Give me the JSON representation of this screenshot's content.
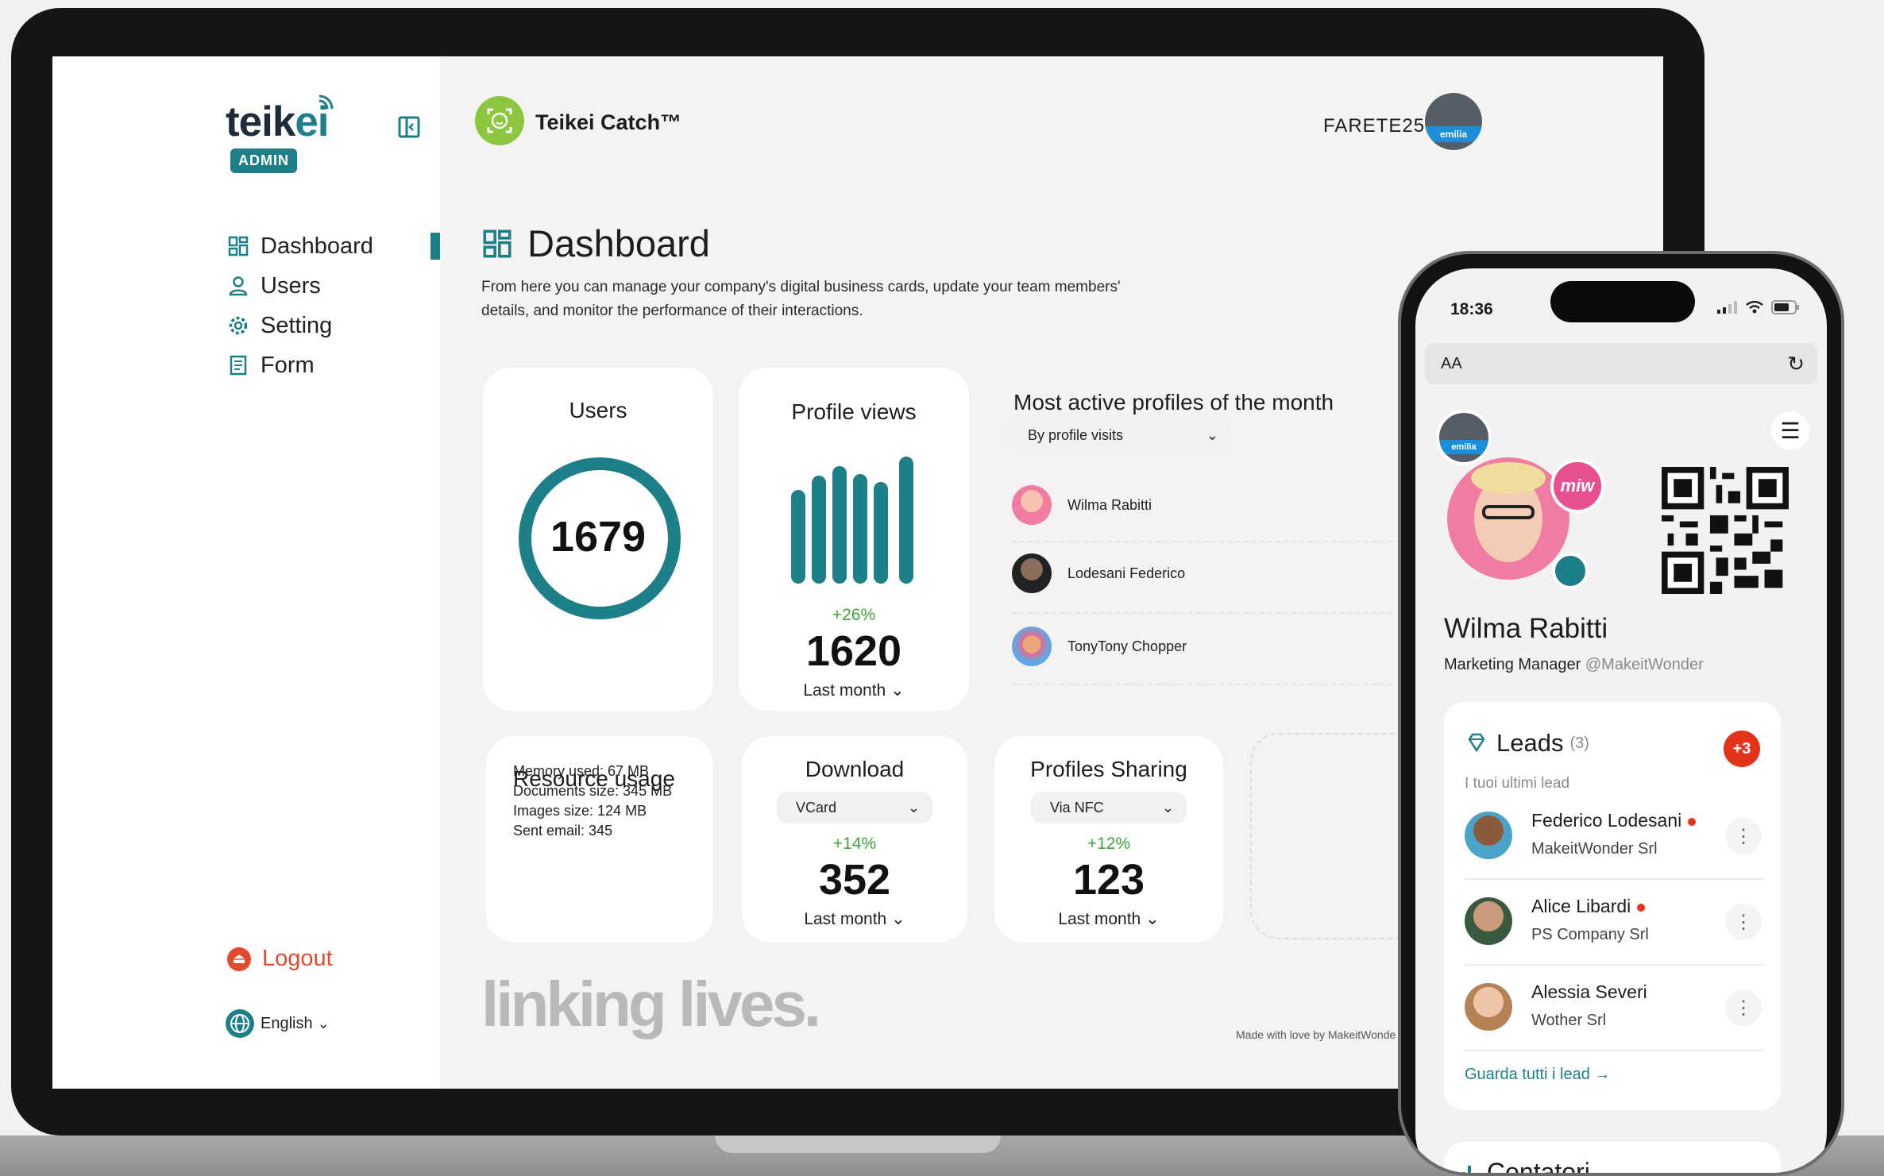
{
  "sidebar": {
    "logo_text_main": "teik",
    "logo_text_accent": "ei",
    "badge": "ADMIN",
    "items": [
      {
        "label": "Dashboard",
        "icon": "dashboard-icon"
      },
      {
        "label": "Users",
        "icon": "user-icon"
      },
      {
        "label": "Setting",
        "icon": "gear-icon"
      },
      {
        "label": "Form",
        "icon": "form-icon"
      }
    ],
    "logout_label": "Logout",
    "language_label": "English"
  },
  "header": {
    "app_name": "Teikei Catch™",
    "company_code": "FARETE25",
    "company_logo_text": "emilia"
  },
  "main": {
    "title": "Dashboard",
    "description": "From here you can manage your company's digital business cards, update your team members' details, and monitor the performance of their interactions.",
    "users_card": {
      "title": "Users",
      "value": "1679"
    },
    "profile_views_card": {
      "title": "Profile views",
      "change": "+26%",
      "value": "1620",
      "period": "Last month"
    },
    "active_profiles": {
      "title": "Most active profiles of the month",
      "filter": "By profile visits",
      "profiles": [
        {
          "name": "Wilma Rabitti"
        },
        {
          "name": "Lodesani Federico"
        },
        {
          "name": "TonyTony Chopper"
        }
      ]
    },
    "resource_usage": {
      "title": "Resource usage",
      "lines": [
        "Memory used: 67 MB",
        "Documents size: 345 MB",
        "Images size: 124 MB",
        "Sent email: 345"
      ]
    },
    "download_card": {
      "title": "Download",
      "filter": "VCard",
      "change": "+14%",
      "value": "352",
      "period": "Last month"
    },
    "sharing_card": {
      "title": "Profiles Sharing",
      "filter": "Via NFC",
      "change": "+12%",
      "value": "123",
      "period": "Last month"
    },
    "tagline": "linking lives.",
    "footer": "Made with love by MakeitWonde"
  },
  "phone": {
    "time": "18:36",
    "url_text": "AA",
    "logo_text": "emilia",
    "badge_text": "miw",
    "name": "Wilma Rabitti",
    "role": "Marketing Manager",
    "handle": "@MakeitWonder",
    "leads": {
      "title": "Leads",
      "count": "(3)",
      "badge": "+3",
      "subtitle": "I tuoi ultimi lead",
      "items": [
        {
          "name": "Federico Lodesani",
          "company": "MakeitWonder Srl"
        },
        {
          "name": "Alice Libardi",
          "company": "PS Company Srl"
        },
        {
          "name": "Alessia Severi",
          "company": "Wother Srl"
        }
      ],
      "link": "Guarda tutti i lead →"
    },
    "counters_title": "Contatori"
  },
  "colors": {
    "accent": "#1d7f88",
    "positive": "#3ea53a",
    "danger": "#e5331a",
    "brand_green": "#8dc63f"
  }
}
